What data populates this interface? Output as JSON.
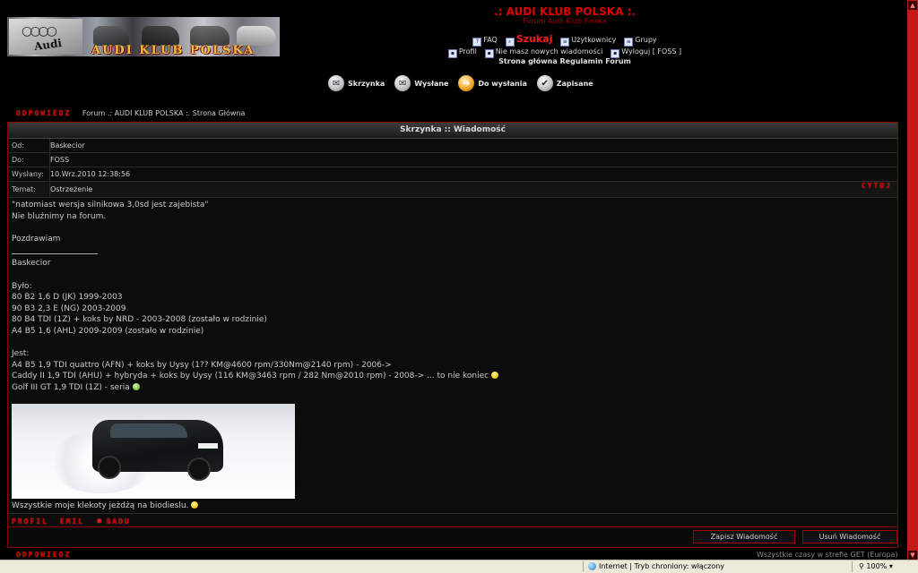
{
  "banner": {
    "title": "AUDI KLUB POLSKA",
    "logo_text": "Audi"
  },
  "header": {
    "site_title": ".: AUDI KLUB POLSKA :.",
    "site_subtitle": "Forum Audi Klub Polska",
    "nav_row1": [
      {
        "label": "FAQ"
      },
      {
        "label": "Szukaj"
      },
      {
        "label": "Użytkownicy"
      },
      {
        "label": "Grupy"
      }
    ],
    "nav_row2": [
      {
        "label": "Profil"
      },
      {
        "label": "Nie masz nowych wiadomości"
      },
      {
        "label": "Wyloguj [ FOSS ]"
      }
    ],
    "nav_row3": "Strona główna Regulamin Forum"
  },
  "folders": [
    {
      "label": "Skrzynka"
    },
    {
      "label": "Wysłane"
    },
    {
      "label": "Do wysłania"
    },
    {
      "label": "Zapisane"
    }
  ],
  "crumb": {
    "reply_label": "ODPOWIEDZ",
    "path": "Forum .: AUDI KLUB POLSKA :. Strona Główna"
  },
  "message": {
    "panel_title": "Skrzynka :: Wiadomość",
    "from_label": "Od:",
    "from": "Baskecior",
    "to_label": "Do:",
    "to": "FOSS",
    "sent_label": "Wysłany:",
    "sent": "10.Wrz.2010 12:38:56",
    "subject_label": "Temat:",
    "subject": "Ostrzeżenie",
    "quote_label": "CYTUJ",
    "body": [
      "\"natomiast wersja silnikowa 3,0sd jest zajebista\"",
      "Nie bluźnimy na forum.",
      "",
      "Pozdrawiam"
    ],
    "signature_name": "Baskecior",
    "signature": [
      "Było:",
      "80 B2 1,6 D (JK) 1999-2003",
      "90 B3 2,3 E (NG) 2003-2009",
      "80 B4 TDI (1Z) + koks by NRD - 2003-2008 (zostało w rodzinie)",
      "A4 B5 1,6 (AHL) 2009-2009 (zostało w rodzinie)",
      "",
      "Jest:",
      "A4 B5 1,9 TDI quattro (AFN) + koks by Uysy (1?? KM@4600 rpm/330Nm@2140 rpm) - 2006->",
      "Caddy II 1,9 TDI (AHU) + hybryda + koks by Uysy (116 KM@3463 rpm / 282 Nm@2010 rpm) - 2008-> ... to nie koniec",
      "Golf III GT 1,9 TDI (1Z) - seria"
    ],
    "signature_end": "Wszystkie moje klekoty jeżdżą na biodieslu.",
    "plate_text": "",
    "actions": [
      "PROFIL",
      "EMIL",
      "GADU"
    ],
    "save_label": "Zapisz Wiadomość",
    "delete_label": "Usuń Wiadomość"
  },
  "footer": {
    "reply_label": "ODPOWIEDZ",
    "timezone": "Wszystkie czasy w strefie GET (Europa)"
  },
  "statusbar": {
    "zone": "Internet | Tryb chroniony: włączony",
    "zoom": "100%"
  },
  "colors": {
    "accent_red": "#e00000",
    "panel_border": "#8a0000",
    "background": "#000000"
  }
}
